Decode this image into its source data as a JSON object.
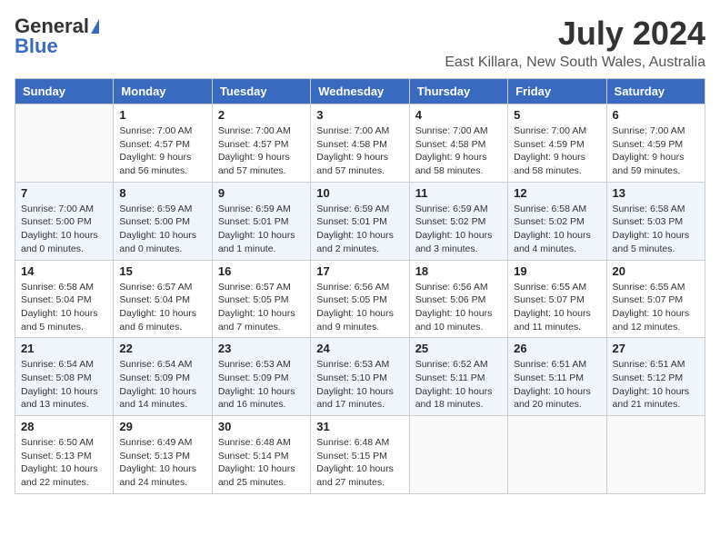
{
  "logo": {
    "general": "General",
    "blue": "Blue"
  },
  "title": "July 2024",
  "subtitle": "East Killara, New South Wales, Australia",
  "days_header": [
    "Sunday",
    "Monday",
    "Tuesday",
    "Wednesday",
    "Thursday",
    "Friday",
    "Saturday"
  ],
  "weeks": [
    [
      {
        "num": "",
        "info": ""
      },
      {
        "num": "1",
        "info": "Sunrise: 7:00 AM\nSunset: 4:57 PM\nDaylight: 9 hours\nand 56 minutes."
      },
      {
        "num": "2",
        "info": "Sunrise: 7:00 AM\nSunset: 4:57 PM\nDaylight: 9 hours\nand 57 minutes."
      },
      {
        "num": "3",
        "info": "Sunrise: 7:00 AM\nSunset: 4:58 PM\nDaylight: 9 hours\nand 57 minutes."
      },
      {
        "num": "4",
        "info": "Sunrise: 7:00 AM\nSunset: 4:58 PM\nDaylight: 9 hours\nand 58 minutes."
      },
      {
        "num": "5",
        "info": "Sunrise: 7:00 AM\nSunset: 4:59 PM\nDaylight: 9 hours\nand 58 minutes."
      },
      {
        "num": "6",
        "info": "Sunrise: 7:00 AM\nSunset: 4:59 PM\nDaylight: 9 hours\nand 59 minutes."
      }
    ],
    [
      {
        "num": "7",
        "info": "Sunrise: 7:00 AM\nSunset: 5:00 PM\nDaylight: 10 hours\nand 0 minutes."
      },
      {
        "num": "8",
        "info": "Sunrise: 6:59 AM\nSunset: 5:00 PM\nDaylight: 10 hours\nand 0 minutes."
      },
      {
        "num": "9",
        "info": "Sunrise: 6:59 AM\nSunset: 5:01 PM\nDaylight: 10 hours\nand 1 minute."
      },
      {
        "num": "10",
        "info": "Sunrise: 6:59 AM\nSunset: 5:01 PM\nDaylight: 10 hours\nand 2 minutes."
      },
      {
        "num": "11",
        "info": "Sunrise: 6:59 AM\nSunset: 5:02 PM\nDaylight: 10 hours\nand 3 minutes."
      },
      {
        "num": "12",
        "info": "Sunrise: 6:58 AM\nSunset: 5:02 PM\nDaylight: 10 hours\nand 4 minutes."
      },
      {
        "num": "13",
        "info": "Sunrise: 6:58 AM\nSunset: 5:03 PM\nDaylight: 10 hours\nand 5 minutes."
      }
    ],
    [
      {
        "num": "14",
        "info": "Sunrise: 6:58 AM\nSunset: 5:04 PM\nDaylight: 10 hours\nand 5 minutes."
      },
      {
        "num": "15",
        "info": "Sunrise: 6:57 AM\nSunset: 5:04 PM\nDaylight: 10 hours\nand 6 minutes."
      },
      {
        "num": "16",
        "info": "Sunrise: 6:57 AM\nSunset: 5:05 PM\nDaylight: 10 hours\nand 7 minutes."
      },
      {
        "num": "17",
        "info": "Sunrise: 6:56 AM\nSunset: 5:05 PM\nDaylight: 10 hours\nand 9 minutes."
      },
      {
        "num": "18",
        "info": "Sunrise: 6:56 AM\nSunset: 5:06 PM\nDaylight: 10 hours\nand 10 minutes."
      },
      {
        "num": "19",
        "info": "Sunrise: 6:55 AM\nSunset: 5:07 PM\nDaylight: 10 hours\nand 11 minutes."
      },
      {
        "num": "20",
        "info": "Sunrise: 6:55 AM\nSunset: 5:07 PM\nDaylight: 10 hours\nand 12 minutes."
      }
    ],
    [
      {
        "num": "21",
        "info": "Sunrise: 6:54 AM\nSunset: 5:08 PM\nDaylight: 10 hours\nand 13 minutes."
      },
      {
        "num": "22",
        "info": "Sunrise: 6:54 AM\nSunset: 5:09 PM\nDaylight: 10 hours\nand 14 minutes."
      },
      {
        "num": "23",
        "info": "Sunrise: 6:53 AM\nSunset: 5:09 PM\nDaylight: 10 hours\nand 16 minutes."
      },
      {
        "num": "24",
        "info": "Sunrise: 6:53 AM\nSunset: 5:10 PM\nDaylight: 10 hours\nand 17 minutes."
      },
      {
        "num": "25",
        "info": "Sunrise: 6:52 AM\nSunset: 5:11 PM\nDaylight: 10 hours\nand 18 minutes."
      },
      {
        "num": "26",
        "info": "Sunrise: 6:51 AM\nSunset: 5:11 PM\nDaylight: 10 hours\nand 20 minutes."
      },
      {
        "num": "27",
        "info": "Sunrise: 6:51 AM\nSunset: 5:12 PM\nDaylight: 10 hours\nand 21 minutes."
      }
    ],
    [
      {
        "num": "28",
        "info": "Sunrise: 6:50 AM\nSunset: 5:13 PM\nDaylight: 10 hours\nand 22 minutes."
      },
      {
        "num": "29",
        "info": "Sunrise: 6:49 AM\nSunset: 5:13 PM\nDaylight: 10 hours\nand 24 minutes."
      },
      {
        "num": "30",
        "info": "Sunrise: 6:48 AM\nSunset: 5:14 PM\nDaylight: 10 hours\nand 25 minutes."
      },
      {
        "num": "31",
        "info": "Sunrise: 6:48 AM\nSunset: 5:15 PM\nDaylight: 10 hours\nand 27 minutes."
      },
      {
        "num": "",
        "info": ""
      },
      {
        "num": "",
        "info": ""
      },
      {
        "num": "",
        "info": ""
      }
    ]
  ]
}
